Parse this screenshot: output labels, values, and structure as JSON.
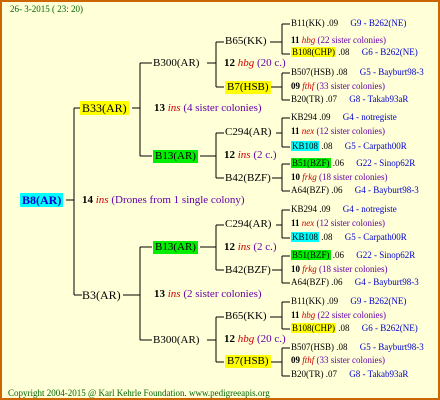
{
  "header": "26-  3-2015 ( 23: 20)",
  "root": "B8(AR)",
  "root_info": {
    "num": "14",
    "ins": "ins",
    "text": "(Drones from 1 single colony)"
  },
  "gen2": [
    "B33(AR)",
    "B3(AR)"
  ],
  "gen2_info": [
    {
      "num": "13",
      "ins": "ins",
      "text": "(4 sister colonies)"
    },
    {
      "num": "13",
      "ins": "ins",
      "text": "(2 sister colonies)"
    }
  ],
  "gen3": [
    "B300(AR)",
    "B13(AR)",
    "B13(AR)",
    "B300(AR)"
  ],
  "gen3_info": [
    {
      "num": "12",
      "ins": "hbg",
      "text": "(20 c.)"
    },
    {
      "num": "12",
      "ins": "ins",
      "text": "(2 c.)"
    },
    {
      "num": "12",
      "ins": "ins",
      "text": "(2 c.)"
    },
    {
      "num": "12",
      "ins": "hbg",
      "text": "(20 c.)"
    }
  ],
  "gen4": [
    "B65(KK)",
    "B7(HSB)",
    "C294(AR)",
    "B42(BZF)",
    "C294(AR)",
    "B42(BZF)",
    "B65(KK)",
    "B7(HSB)"
  ],
  "gen5": [
    {
      "name": "B11(KK)",
      "val": ".09",
      "origin": "G9 - B262(NE)",
      "hl": ""
    },
    {
      "num": "11",
      "ins": "hbg",
      "text": "(22 sister colonies)"
    },
    {
      "name": "B108(CHP)",
      "val": ".08",
      "origin": "G6 - B262(NE)",
      "hl": "#ffff00"
    },
    {
      "name": "B507(HSB)",
      "val": ".08",
      "origin": "G5 - Bayburt98-3",
      "hl": ""
    },
    {
      "num": "09",
      "ins": "fthf",
      "text": "(33 sister colonies)"
    },
    {
      "name": "B20(TR)",
      "val": ".07",
      "origin": "G8 - Takab93aR",
      "hl": ""
    },
    {
      "name": "KB294",
      "val": ".09",
      "origin": "G4 - notregiste",
      "hl": ""
    },
    {
      "num": "11",
      "ins": "nex",
      "text": "(12 sister colonies)"
    },
    {
      "name": "KB108",
      "val": ".08",
      "origin": "G5 - Carpath00R",
      "hl": "#00ffff"
    },
    {
      "name": "B51(BZF)",
      "val": ".06",
      "origin": "G22 - Sinop62R",
      "hl": "#00ee00"
    },
    {
      "num": "10",
      "ins": "frkg",
      "text": "(18 sister colonies)"
    },
    {
      "name": "A64(BZF)",
      "val": ".06",
      "origin": "G4 - Bayburt98-3",
      "hl": ""
    },
    {
      "name": "KB294",
      "val": ".09",
      "origin": "G4 - notregiste",
      "hl": ""
    },
    {
      "num": "11",
      "ins": "nex",
      "text": "(12 sister colonies)"
    },
    {
      "name": "KB108",
      "val": ".08",
      "origin": "G5 - Carpath00R",
      "hl": "#00ffff"
    },
    {
      "name": "B51(BZF)",
      "val": ".06",
      "origin": "G22 - Sinop62R",
      "hl": "#00ee00"
    },
    {
      "num": "10",
      "ins": "frkg",
      "text": "(18 sister colonies)"
    },
    {
      "name": "A64(BZF)",
      "val": ".06",
      "origin": "G4 - Bayburt98-3",
      "hl": ""
    },
    {
      "name": "B11(KK)",
      "val": ".09",
      "origin": "G9 - B262(NE)",
      "hl": ""
    },
    {
      "num": "11",
      "ins": "hbg",
      "text": "(22 sister colonies)"
    },
    {
      "name": "B108(CHP)",
      "val": ".08",
      "origin": "G6 - B262(NE)",
      "hl": "#ffff00"
    },
    {
      "name": "B507(HSB)",
      "val": ".08",
      "origin": "G5 - Bayburt98-3",
      "hl": ""
    },
    {
      "num": "09",
      "ins": "fthf",
      "text": "(33 sister colonies)"
    },
    {
      "name": "B20(TR)",
      "val": ".07",
      "origin": "G8 - Takab93aR",
      "hl": ""
    }
  ],
  "footer": "Copyright 2004-2015 @ Karl Kehrle Foundation.   www.pedigreeapis.org"
}
